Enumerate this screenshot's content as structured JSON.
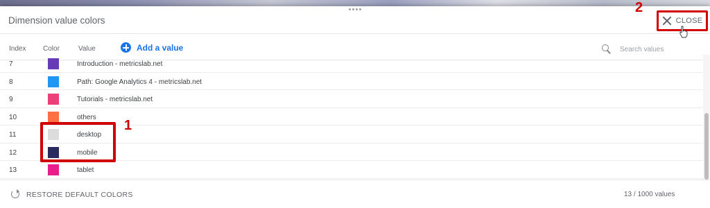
{
  "header": {
    "title": "Dimension value colors",
    "close_label": "CLOSE"
  },
  "annotations": {
    "marker_1": "1",
    "marker_2": "2"
  },
  "columns": {
    "index": "Index",
    "color": "Color",
    "value": "Value"
  },
  "add_value_label": "Add a value",
  "search": {
    "placeholder": "Search values"
  },
  "rows": [
    {
      "index": "7",
      "color": "#673ab7",
      "value": "Introduction - metricslab.net"
    },
    {
      "index": "8",
      "color": "#2196f3",
      "value": "Path: Google Analytics 4 - metricslab.net"
    },
    {
      "index": "9",
      "color": "#ec407a",
      "value": "Tutorials - metricslab.net"
    },
    {
      "index": "10",
      "color": "#ff7043",
      "value": "others"
    },
    {
      "index": "11",
      "color": "#dcdcdc",
      "value": "desktop"
    },
    {
      "index": "12",
      "color": "#2b2a5e",
      "value": "mobile"
    },
    {
      "index": "13",
      "color": "#e91e8c",
      "value": "tablet"
    }
  ],
  "footer": {
    "restore_label": "RESTORE DEFAULT COLORS",
    "count": "13 / 1000 values"
  },
  "colors": {
    "accent": "#1a73e8",
    "annotation_red": "#d10000"
  }
}
